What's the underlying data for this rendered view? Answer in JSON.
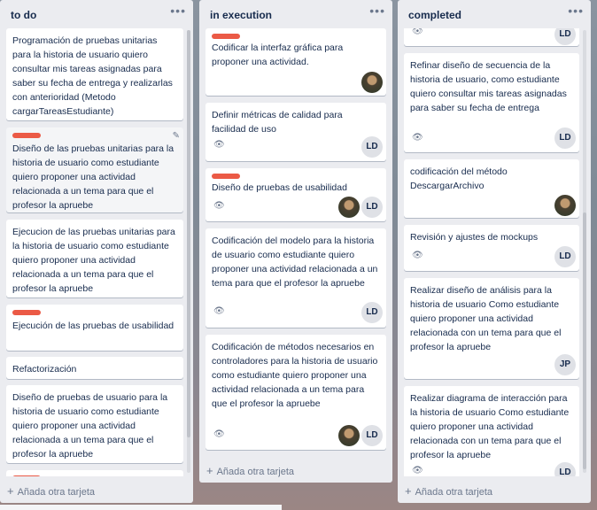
{
  "board": {
    "add_card_label": "Añada otra tarjeta",
    "label_color": "#eb5a46",
    "lists": [
      {
        "title": "to do",
        "cards": [
          {
            "label": false,
            "text": "Programación de pruebas unitarias para la historia de usuario quiero consultar mis tareas asignadas para saber su fecha de entrega y realizarlas con anterioridad (Metodo cargarTareasEstudiante)"
          },
          {
            "label": true,
            "text": "Diseño de las pruebas unitarias para la historia de usuario como estudiante quiero proponer una actividad relacionada a un tema para que el profesor la apruebe"
          },
          {
            "label": false,
            "text": "Ejecucion de las pruebas unitarias para la historia de usuario como estudiante quiero proponer una actividad relacionada a un tema para que el profesor la apruebe"
          },
          {
            "label": true,
            "text": "Ejecución de las pruebas de usabilidad"
          },
          {
            "label": false,
            "text": "Refactorización"
          },
          {
            "label": false,
            "text": "Diseño de pruebas de usuario para la historia de usuario como estudiante quiero proponer una actividad relacionada a un tema para que el profesor la apruebe"
          },
          {
            "label": true,
            "text": ""
          }
        ]
      },
      {
        "title": "in execution",
        "cards": [
          {
            "label": true,
            "text": "Codificar la interfaz gráfica para proponer una actividad.",
            "avatars": [
              "photo"
            ]
          },
          {
            "label": false,
            "text": "Definir métricas de calidad para facilidad de uso",
            "watch": true,
            "avatars": [
              "LD"
            ]
          },
          {
            "label": true,
            "text": "Diseño de pruebas de usabilidad",
            "watch": true,
            "avatars": [
              "photo",
              "LD"
            ]
          },
          {
            "label": false,
            "text": "Codificación del modelo para la historia de usuario como estudiante quiero proponer una actividad relacionada a un tema para que el profesor la apruebe",
            "watch": true,
            "avatars": [
              "LD"
            ]
          },
          {
            "label": false,
            "text": "Codificación de métodos necesarios en controladores para la historia de usuario como estudiante quiero proponer una actividad relacionada a un tema para que el profesor la apruebe",
            "watch": true,
            "avatars": [
              "photo",
              "LD"
            ]
          }
        ]
      },
      {
        "title": "completed",
        "cards": [
          {
            "label": false,
            "text": "",
            "watch": true,
            "avatars": [
              "LD"
            ]
          },
          {
            "label": false,
            "text": "Refinar diseño de secuencia de la historia de usuario, como estudiante quiero consultar mis tareas asignadas para saber su fecha de entrega",
            "watch": true,
            "avatars": [
              "LD"
            ]
          },
          {
            "label": false,
            "text": "codificación del método DescargarArchivo",
            "avatars": [
              "photo"
            ]
          },
          {
            "label": false,
            "text": "Revisión y ajustes de mockups",
            "watch": true,
            "avatars": [
              "LD"
            ]
          },
          {
            "label": false,
            "text": "Realizar diseño de análisis para la historia de usuario Como estudiante quiero proponer una actividad relacionada con un tema para que el profesor la apruebe",
            "avatars": [
              "JP"
            ]
          },
          {
            "label": false,
            "text": "Realizar diagrama de interacción para la historia de usuario Como estudiante quiero proponer una actividad relacionada con un tema para que el profesor la apruebe",
            "watch": true,
            "avatars": [
              "LD"
            ]
          }
        ]
      }
    ]
  }
}
